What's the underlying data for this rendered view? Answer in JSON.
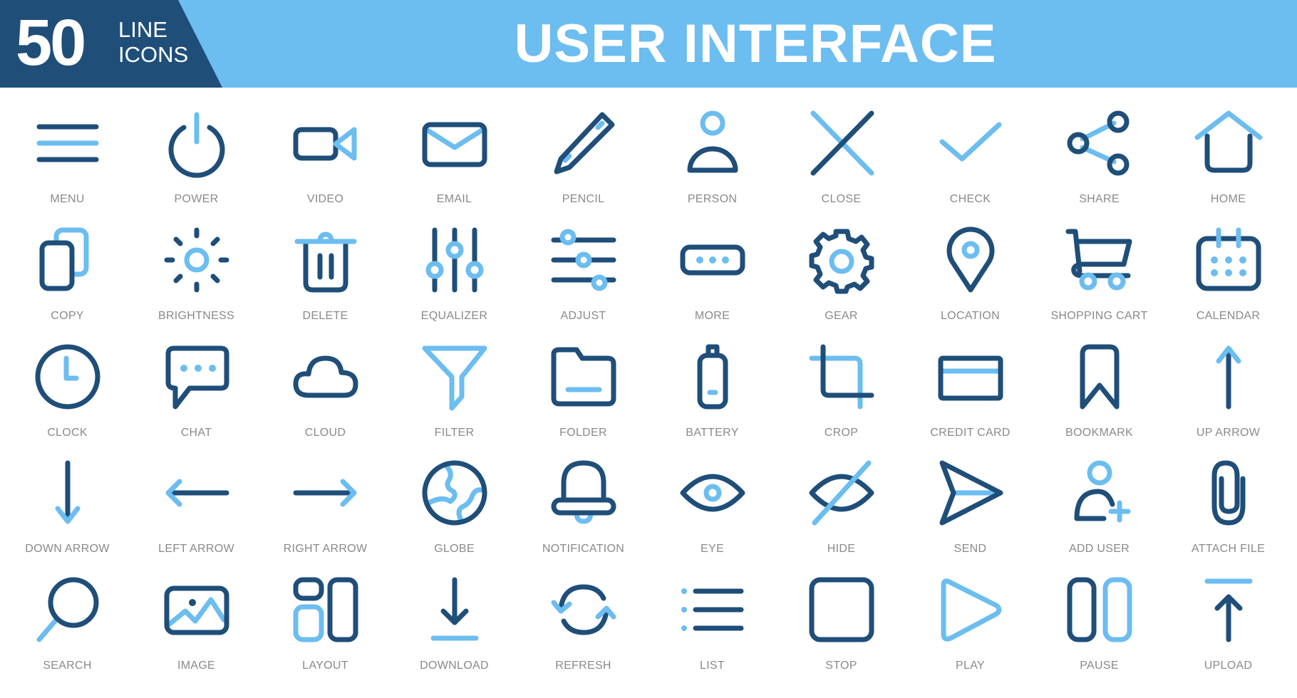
{
  "header": {
    "count": "50",
    "subtitle_line1": "LINE",
    "subtitle_line2": "ICONS",
    "title": "USER INTERFACE"
  },
  "colors": {
    "dark_blue": "#1f4e79",
    "light_blue": "#6cbdf0",
    "label_gray": "#8a8a8a",
    "background": "#ffffff"
  },
  "icons": [
    {
      "name": "menu",
      "label": "MENU"
    },
    {
      "name": "power",
      "label": "POWER"
    },
    {
      "name": "video",
      "label": "VIDEO"
    },
    {
      "name": "email",
      "label": "EMAIL"
    },
    {
      "name": "pencil",
      "label": "PENCIL"
    },
    {
      "name": "person",
      "label": "PERSON"
    },
    {
      "name": "close",
      "label": "CLOSE"
    },
    {
      "name": "check",
      "label": "CHECK"
    },
    {
      "name": "share",
      "label": "SHARE"
    },
    {
      "name": "home",
      "label": "HOME"
    },
    {
      "name": "copy",
      "label": "COPY"
    },
    {
      "name": "brightness",
      "label": "BRIGHTNESS"
    },
    {
      "name": "delete",
      "label": "DELETE"
    },
    {
      "name": "equalizer",
      "label": "EQUALIZER"
    },
    {
      "name": "adjust",
      "label": "ADJUST"
    },
    {
      "name": "more",
      "label": "MORE"
    },
    {
      "name": "gear",
      "label": "GEAR"
    },
    {
      "name": "location",
      "label": "LOCATION"
    },
    {
      "name": "shopping-cart",
      "label": "SHOPPING CART"
    },
    {
      "name": "calendar",
      "label": "CALENDAR"
    },
    {
      "name": "clock",
      "label": "CLOCK"
    },
    {
      "name": "chat",
      "label": "CHAT"
    },
    {
      "name": "cloud",
      "label": "CLOUD"
    },
    {
      "name": "filter",
      "label": "FILTER"
    },
    {
      "name": "folder",
      "label": "FOLDER"
    },
    {
      "name": "battery",
      "label": "BATTERY"
    },
    {
      "name": "crop",
      "label": "CROP"
    },
    {
      "name": "credit-card",
      "label": "CREDIT CARD"
    },
    {
      "name": "bookmark",
      "label": "BOOKMARK"
    },
    {
      "name": "up-arrow",
      "label": "UP ARROW"
    },
    {
      "name": "down-arrow",
      "label": "DOWN ARROW"
    },
    {
      "name": "left-arrow",
      "label": "LEFT ARROW"
    },
    {
      "name": "right-arrow",
      "label": "RIGHT ARROW"
    },
    {
      "name": "globe",
      "label": "GLOBE"
    },
    {
      "name": "notification",
      "label": "NOTIFICATION"
    },
    {
      "name": "eye",
      "label": "EYE"
    },
    {
      "name": "hide",
      "label": "HIDE"
    },
    {
      "name": "send",
      "label": "SEND"
    },
    {
      "name": "add-user",
      "label": "ADD USER"
    },
    {
      "name": "attach-file",
      "label": "ATTACH FILE"
    },
    {
      "name": "search",
      "label": "SEARCH"
    },
    {
      "name": "image",
      "label": "IMAGE"
    },
    {
      "name": "layout",
      "label": "LAYOUT"
    },
    {
      "name": "download",
      "label": "DOWNLOAD"
    },
    {
      "name": "refresh",
      "label": "REFRESH"
    },
    {
      "name": "list",
      "label": "LIST"
    },
    {
      "name": "stop",
      "label": "STOP"
    },
    {
      "name": "play",
      "label": "PLAY"
    },
    {
      "name": "pause",
      "label": "PAUSE"
    },
    {
      "name": "upload",
      "label": "UPLOAD"
    }
  ]
}
